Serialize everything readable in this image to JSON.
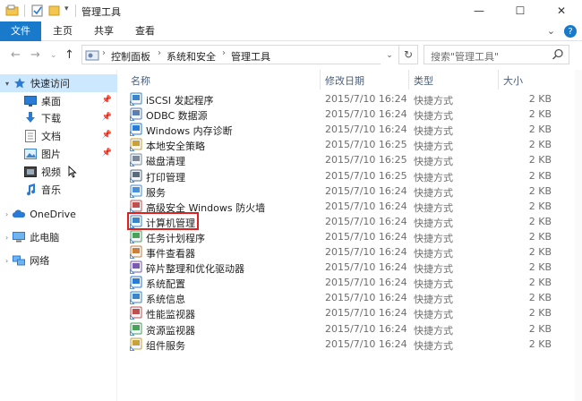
{
  "window": {
    "title": "管理工具",
    "minimize": "—",
    "maximize": "☐",
    "close": "✕"
  },
  "ribbon": {
    "tabs": [
      {
        "label": "文件",
        "active": true
      },
      {
        "label": "主页"
      },
      {
        "label": "共享"
      },
      {
        "label": "查看"
      }
    ],
    "collapse_glyph": "⌄",
    "help_glyph": "?"
  },
  "address": {
    "breadcrumbs": [
      "控制面板",
      "系统和安全",
      "管理工具"
    ],
    "search_placeholder": "搜索\"管理工具\""
  },
  "nav": {
    "quick_access": "快速访问",
    "quick_items": [
      {
        "label": "桌面",
        "pinned": true,
        "icon": "desktop-icon"
      },
      {
        "label": "下载",
        "pinned": true,
        "icon": "download-icon"
      },
      {
        "label": "文档",
        "pinned": true,
        "icon": "document-icon"
      },
      {
        "label": "图片",
        "pinned": true,
        "icon": "picture-icon"
      },
      {
        "label": "视频",
        "pinned": false,
        "icon": "video-icon"
      },
      {
        "label": "音乐",
        "pinned": false,
        "icon": "music-icon"
      }
    ],
    "onedrive": "OneDrive",
    "this_pc": "此电脑",
    "network": "网络"
  },
  "columns": {
    "name": "名称",
    "date": "修改日期",
    "type": "类型",
    "size": "大小"
  },
  "files": [
    {
      "name": "iSCSI 发起程序",
      "date": "2015/7/10 16:24",
      "type": "快捷方式",
      "size": "2 KB",
      "icon": "iscsi-icon"
    },
    {
      "name": "ODBC 数据源",
      "date": "2015/7/10 16:24",
      "type": "快捷方式",
      "size": "2 KB",
      "icon": "odbc-icon"
    },
    {
      "name": "Windows 内存诊断",
      "date": "2015/7/10 16:24",
      "type": "快捷方式",
      "size": "2 KB",
      "icon": "memory-diagnostic-icon"
    },
    {
      "name": "本地安全策略",
      "date": "2015/7/10 16:25",
      "type": "快捷方式",
      "size": "2 KB",
      "icon": "security-policy-icon"
    },
    {
      "name": "磁盘清理",
      "date": "2015/7/10 16:25",
      "type": "快捷方式",
      "size": "2 KB",
      "icon": "disk-cleanup-icon"
    },
    {
      "name": "打印管理",
      "date": "2015/7/10 16:25",
      "type": "快捷方式",
      "size": "2 KB",
      "icon": "print-management-icon"
    },
    {
      "name": "服务",
      "date": "2015/7/10 16:24",
      "type": "快捷方式",
      "size": "2 KB",
      "icon": "services-icon"
    },
    {
      "name": "高级安全 Windows 防火墙",
      "date": "2015/7/10 16:24",
      "type": "快捷方式",
      "size": "2 KB",
      "icon": "firewall-icon"
    },
    {
      "name": "计算机管理",
      "date": "2015/7/10 16:24",
      "type": "快捷方式",
      "size": "2 KB",
      "icon": "computer-management-icon"
    },
    {
      "name": "任务计划程序",
      "date": "2015/7/10 16:24",
      "type": "快捷方式",
      "size": "2 KB",
      "icon": "task-scheduler-icon"
    },
    {
      "name": "事件查看器",
      "date": "2015/7/10 16:24",
      "type": "快捷方式",
      "size": "2 KB",
      "icon": "event-viewer-icon"
    },
    {
      "name": "碎片整理和优化驱动器",
      "date": "2015/7/10 16:24",
      "type": "快捷方式",
      "size": "2 KB",
      "icon": "defrag-icon"
    },
    {
      "name": "系统配置",
      "date": "2015/7/10 16:24",
      "type": "快捷方式",
      "size": "2 KB",
      "icon": "system-config-icon"
    },
    {
      "name": "系统信息",
      "date": "2015/7/10 16:24",
      "type": "快捷方式",
      "size": "2 KB",
      "icon": "system-info-icon"
    },
    {
      "name": "性能监视器",
      "date": "2015/7/10 16:24",
      "type": "快捷方式",
      "size": "2 KB",
      "icon": "performance-monitor-icon"
    },
    {
      "name": "资源监视器",
      "date": "2015/7/10 16:24",
      "type": "快捷方式",
      "size": "2 KB",
      "icon": "resource-monitor-icon"
    },
    {
      "name": "组件服务",
      "date": "2015/7/10 16:24",
      "type": "快捷方式",
      "size": "2 KB",
      "icon": "component-services-icon"
    }
  ],
  "highlighted_file": "计算机管理",
  "colors": {
    "accent": "#1979ca",
    "selection": "#cce8ff",
    "highlight_border": "#e02020"
  }
}
